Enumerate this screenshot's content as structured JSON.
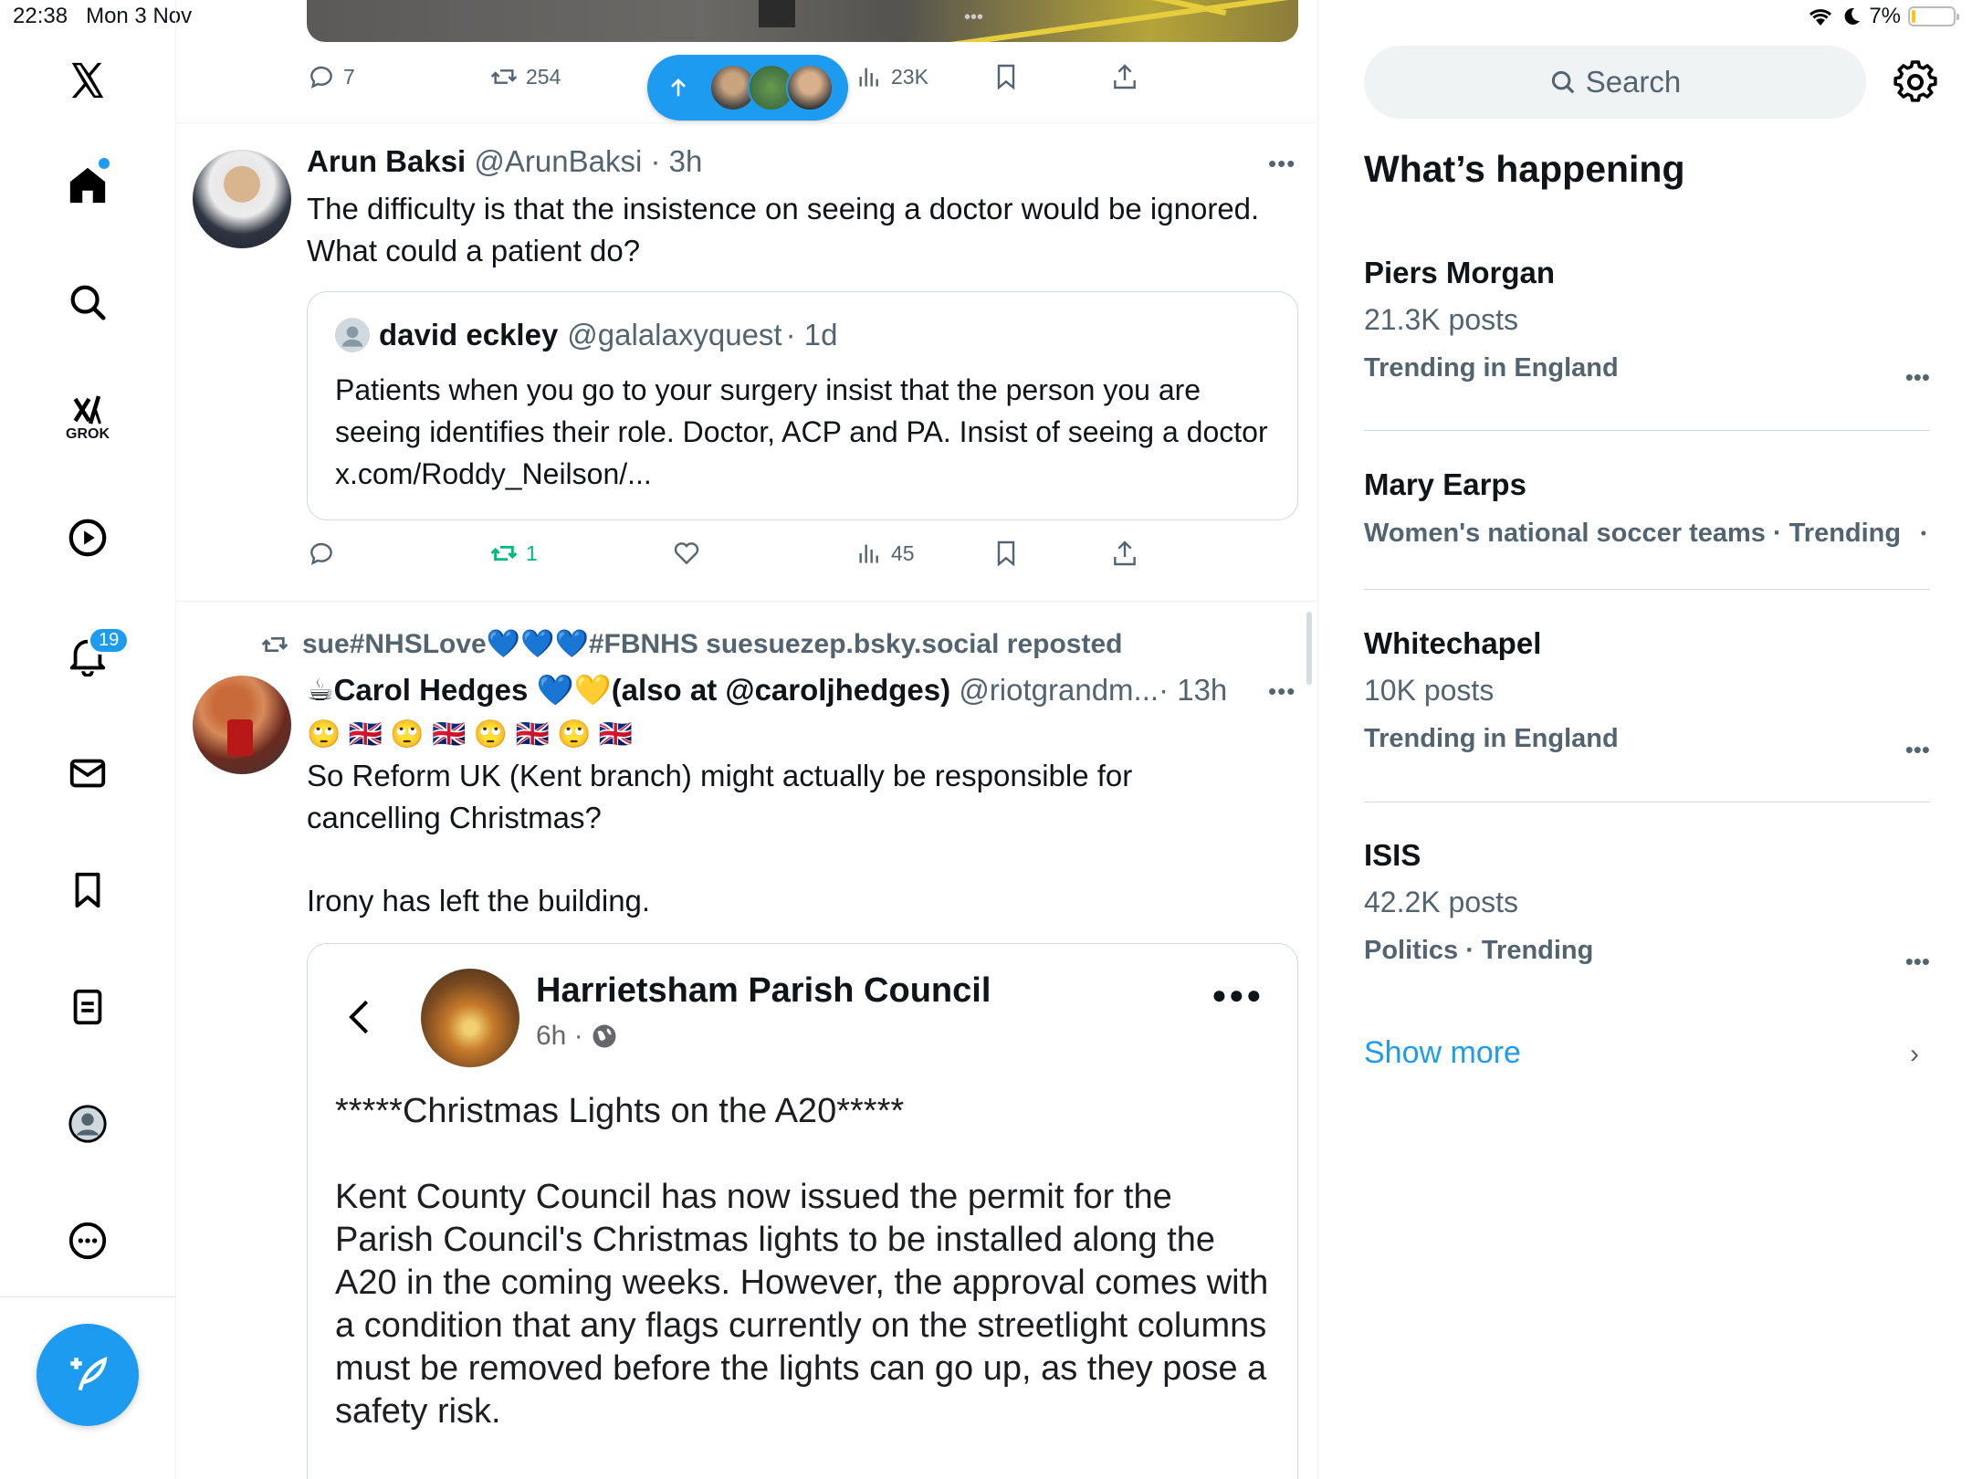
{
  "status": {
    "time": "22:38",
    "date": "Mon 3 Nov",
    "battery": "7%"
  },
  "nav": {
    "notifications_badge": "19",
    "grok_label": "GROK"
  },
  "top_actions": {
    "replies": "7",
    "reposts": "254",
    "views": "23K"
  },
  "tweet1": {
    "name": "Arun Baksi",
    "handle": "@ArunBaksi",
    "time": "· 3h",
    "text": "The difficulty is that the insistence on seeing a doctor would be ignored. What could a patient do?",
    "quote": {
      "name": "david eckley",
      "handle": "@galalaxyquest",
      "time": "· 1d",
      "text": "Patients when you go to your surgery insist that the person you are seeing identifies their role. Doctor, ACP and PA. Insist of seeing a doctor x.com/Roddy_Neilson/..."
    },
    "reposts": "1",
    "views": "45"
  },
  "tweet2": {
    "repost_prefix": "sue#NHSLove",
    "repost_middle": "#FBNHS suesuezep.bsky.social reposted",
    "name_part1": "Carol Hedges",
    "name_part2": "(also at @caroljhedges)",
    "handle": "@riotgrandm...",
    "time": "· 13h",
    "emoji_line": "🙄 🇬🇧 🙄 🇬🇧 🙄 🇬🇧 🙄 🇬🇧",
    "text1": "So Reform UK (Kent branch) might actually be responsible for cancelling Christmas?",
    "text2": "Irony has left the building.",
    "embed": {
      "page_name": "Harrietsham Parish Council",
      "meta": "6h ·",
      "heading": "*****Christmas Lights on the A20*****",
      "body": "Kent County Council has now issued the permit for the Parish Council's Christmas lights to be installed along the A20 in the coming weeks.  However, the approval comes with a condition that any flags currently on the streetlight columns must be removed before the lights can go up, as they pose a safety risk."
    }
  },
  "sidebar": {
    "search_placeholder": "Search",
    "section_title": "What’s happening",
    "trends": [
      {
        "title": "Piers Morgan",
        "posts": "21.3K posts",
        "context": "Trending in England"
      },
      {
        "title": "Mary Earps",
        "context": "Women's national soccer teams · Trending"
      },
      {
        "title": "Whitechapel",
        "posts": "10K posts",
        "context": "Trending in England"
      },
      {
        "title": "ISIS",
        "posts": "42.2K posts",
        "context": "Politics · Trending"
      }
    ],
    "show_more": "Show more"
  },
  "colors": {
    "accent": "#1d9bf0",
    "text": "#0f1419",
    "muted": "#536471",
    "repost_green": "#00ba7c"
  }
}
